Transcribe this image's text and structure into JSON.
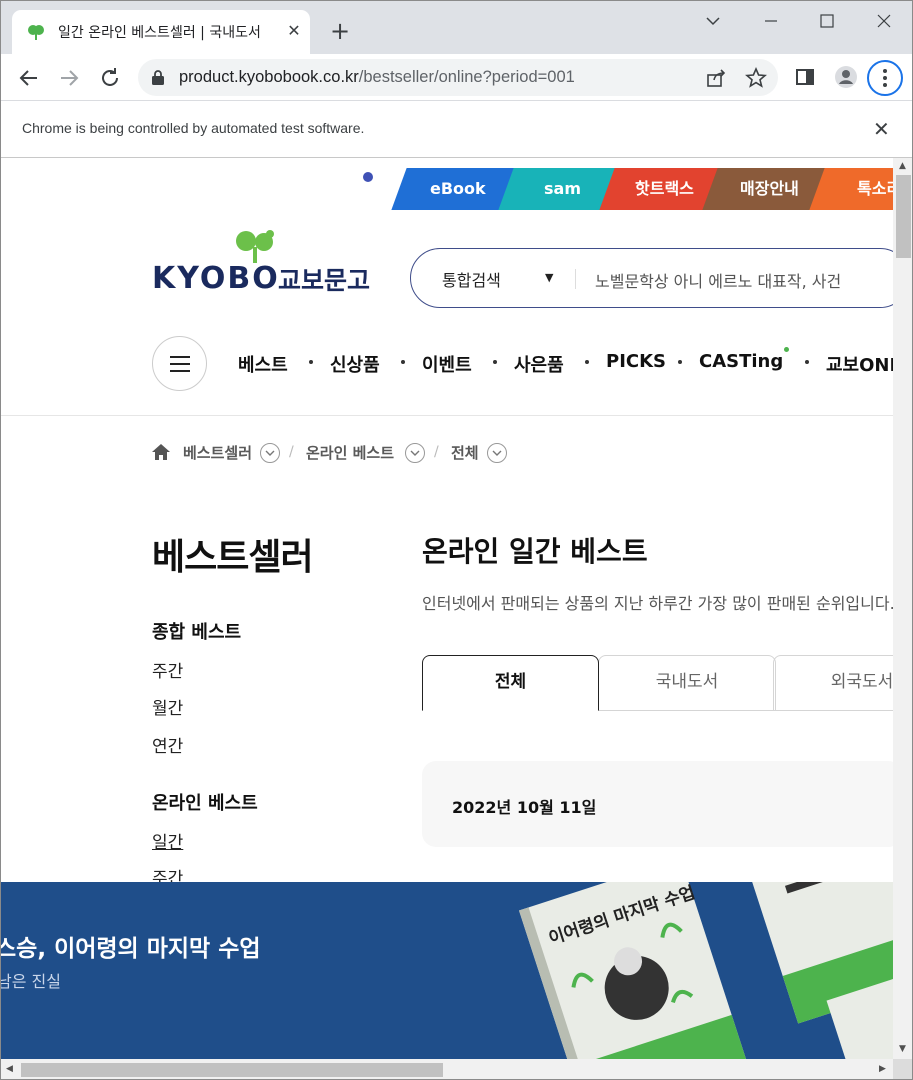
{
  "browser": {
    "tab_title": "일간 온라인 베스트셀러 | 국내도서",
    "url_host": "product.kyobobook.co.kr",
    "url_path": "/bestseller/online?period=001",
    "infobar_text": "Chrome is being controlled by automated test software."
  },
  "service_tabs": [
    "eBook",
    "sam",
    "핫트랙스",
    "매장안내",
    "톡소리"
  ],
  "logo": {
    "text": "KYOBO",
    "kr": "교보문고"
  },
  "search": {
    "category": "통합검색",
    "placeholder": "노벨문학상 아니 에르노 대표작, 사건"
  },
  "gnb": [
    "베스트",
    "신상품",
    "이벤트",
    "사은품",
    "PICKS",
    "CASTing",
    "교보ONLY"
  ],
  "breadcrumb": [
    "베스트셀러",
    "온라인 베스트",
    "전체"
  ],
  "sidebar": {
    "title": "베스트셀러",
    "group1": {
      "head": "종합 베스트",
      "links": [
        "주간",
        "월간",
        "연간"
      ]
    },
    "group2": {
      "head": "온라인 베스트",
      "links": [
        "일간",
        "주간"
      ]
    }
  },
  "main": {
    "title": "온라인 일간 베스트",
    "desc": "인터넷에서 판매되는 상품의 지난 하루간 가장 많이 판매된 순위입니다.",
    "tabs": [
      "전체",
      "국내도서",
      "외국도서"
    ],
    "date": "2022년 10월 11일"
  },
  "promo": {
    "title": "스승, 이어령의 마지막 수업",
    "subtitle": "남은 진실",
    "book_title": "이어령의 마지막 수업"
  },
  "colors": {
    "brand_navy": "#1a2a5e",
    "brand_green": "#4db34d",
    "ebook": "#1f6fd6",
    "sam": "#18b3b8",
    "hottracks": "#e2432f",
    "store": "#8a5a3b",
    "toksori": "#ef6a2a",
    "promo_bg": "#1f4e8a"
  }
}
